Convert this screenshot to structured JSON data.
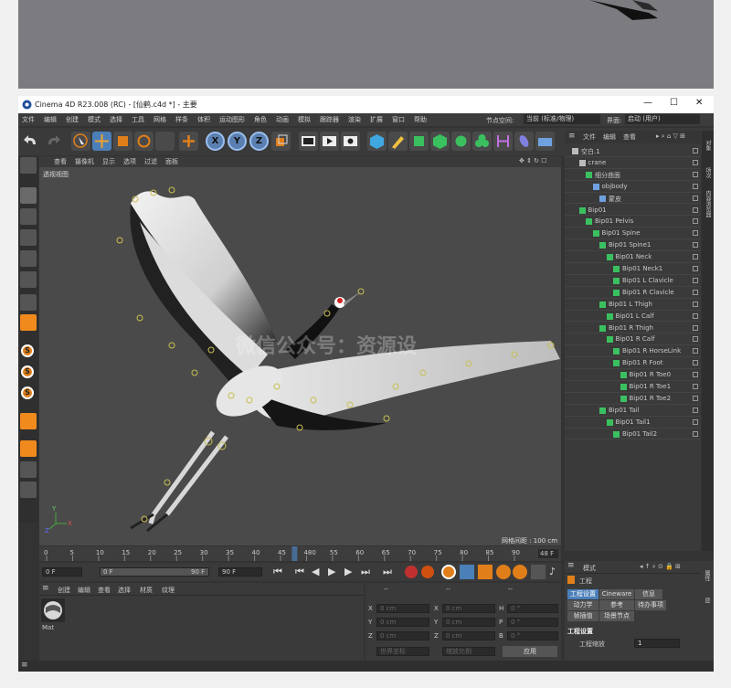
{
  "window": {
    "title": "Cinema 4D R23.008 (RC) - [仙鹤.c4d *] - 主要",
    "min_icon": "minimize-icon",
    "max_icon": "maximize-icon",
    "close_icon": "close-icon"
  },
  "menubar": {
    "items": [
      "文件",
      "编辑",
      "创建",
      "模式",
      "选择",
      "工具",
      "网格",
      "样条",
      "体积",
      "运动图形",
      "角色",
      "动画",
      "模拟",
      "跟踪器",
      "渲染",
      "扩展",
      "窗口",
      "帮助"
    ],
    "node_space_label": "节点空间:",
    "node_space_value": "当前 (标准/物理)",
    "interface_label": "界面:",
    "interface_value": "启动 (用户)"
  },
  "viewport": {
    "menu": [
      "查看",
      "摄像机",
      "显示",
      "选项",
      "过滤",
      "面板"
    ],
    "view_name": "透视视图",
    "grid_spacing": "网格间距 : 100 cm",
    "watermark": "微信公众号：资源设"
  },
  "objects": {
    "menu": [
      "文件",
      "编辑",
      "查看"
    ],
    "rows": [
      {
        "name": "空白.1",
        "indent": 0,
        "icon": "null-icon"
      },
      {
        "name": "crane",
        "indent": 1,
        "icon": "null-icon"
      },
      {
        "name": "细分曲面",
        "indent": 2,
        "icon": "subdivision-icon"
      },
      {
        "name": "objbody",
        "indent": 3,
        "icon": "polygon-icon"
      },
      {
        "name": "蒙皮",
        "indent": 4,
        "icon": "skin-icon"
      },
      {
        "name": "Bip01",
        "indent": 1,
        "icon": "bone-icon"
      },
      {
        "name": "Bip01 Pelvis",
        "indent": 2,
        "icon": "bone-icon"
      },
      {
        "name": "Bip01 Spine",
        "indent": 3,
        "icon": "bone-icon"
      },
      {
        "name": "Bip01 Spine1",
        "indent": 4,
        "icon": "bone-icon"
      },
      {
        "name": "Bip01 Neck",
        "indent": 5,
        "icon": "bone-icon"
      },
      {
        "name": "Bip01 Neck1",
        "indent": 6,
        "icon": "bone-icon"
      },
      {
        "name": "Bip01 L Clavicle",
        "indent": 6,
        "icon": "bone-icon"
      },
      {
        "name": "Bip01 R Clavicle",
        "indent": 6,
        "icon": "bone-icon"
      },
      {
        "name": "Bip01 L Thigh",
        "indent": 4,
        "icon": "bone-icon"
      },
      {
        "name": "Bip01 L Calf",
        "indent": 5,
        "icon": "bone-icon"
      },
      {
        "name": "Bip01 R Thigh",
        "indent": 4,
        "icon": "bone-icon"
      },
      {
        "name": "Bip01 R Calf",
        "indent": 5,
        "icon": "bone-icon"
      },
      {
        "name": "Bip01 R HorseLink",
        "indent": 6,
        "icon": "bone-icon"
      },
      {
        "name": "Bip01 R Foot",
        "indent": 6,
        "icon": "bone-icon"
      },
      {
        "name": "Bip01 R Toe0",
        "indent": 7,
        "icon": "bone-icon"
      },
      {
        "name": "Bip01 R Toe1",
        "indent": 7,
        "icon": "bone-icon"
      },
      {
        "name": "Bip01 R Toe2",
        "indent": 7,
        "icon": "bone-icon"
      },
      {
        "name": "Bip01 Tail",
        "indent": 4,
        "icon": "bone-icon"
      },
      {
        "name": "Bip01 Tail1",
        "indent": 5,
        "icon": "bone-icon"
      },
      {
        "name": "Bip01 Tail2",
        "indent": 6,
        "icon": "bone-icon"
      }
    ],
    "side_tabs": [
      "对象",
      "场次",
      "内容浏览器"
    ]
  },
  "timeline": {
    "ticks": [
      "0",
      "5",
      "10",
      "15",
      "20",
      "25",
      "30",
      "35",
      "40",
      "45",
      "480",
      "55",
      "60",
      "65",
      "70",
      "75",
      "80",
      "85",
      "90"
    ],
    "end_frame": "48 F",
    "current_frame_fraction": 0.53
  },
  "transport": {
    "start": "0 F",
    "min": "0 F",
    "max": "90 F",
    "end": "90 F"
  },
  "material": {
    "menu": [
      "创建",
      "编辑",
      "查看",
      "选择",
      "材质",
      "纹理"
    ],
    "mat_name": "Mat"
  },
  "coords": {
    "headers": [
      "--",
      "--",
      "--"
    ],
    "rows": [
      {
        "a": "X",
        "a_val": "0 cm",
        "b": "X",
        "b_val": "0 cm",
        "c": "H",
        "c_val": "0 °"
      },
      {
        "a": "Y",
        "a_val": "0 cm",
        "b": "Y",
        "b_val": "0 cm",
        "c": "P",
        "c_val": "0 °"
      },
      {
        "a": "Z",
        "a_val": "0 cm",
        "b": "Z",
        "b_val": "0 cm",
        "c": "B",
        "c_val": "0 °"
      }
    ],
    "space": "世界坐标",
    "scale": "缩放比例",
    "apply": "应用"
  },
  "attributes": {
    "menu": [
      "模式"
    ],
    "title": "工程",
    "tabs_row1": [
      "工程设置",
      "Cineware",
      "信息"
    ],
    "tabs_row2": [
      "动力学",
      "参考",
      "待办事项"
    ],
    "tabs_row3": [
      "帧插值",
      "场景节点"
    ],
    "section": "工程设置",
    "scale_label": "工程缩放",
    "scale_value": "1",
    "side_tabs": [
      "属性",
      "层"
    ]
  },
  "colors": {
    "accent": "#4b7fb8",
    "panel": "#3a3a3a",
    "viewport": "#4a4a4a"
  }
}
